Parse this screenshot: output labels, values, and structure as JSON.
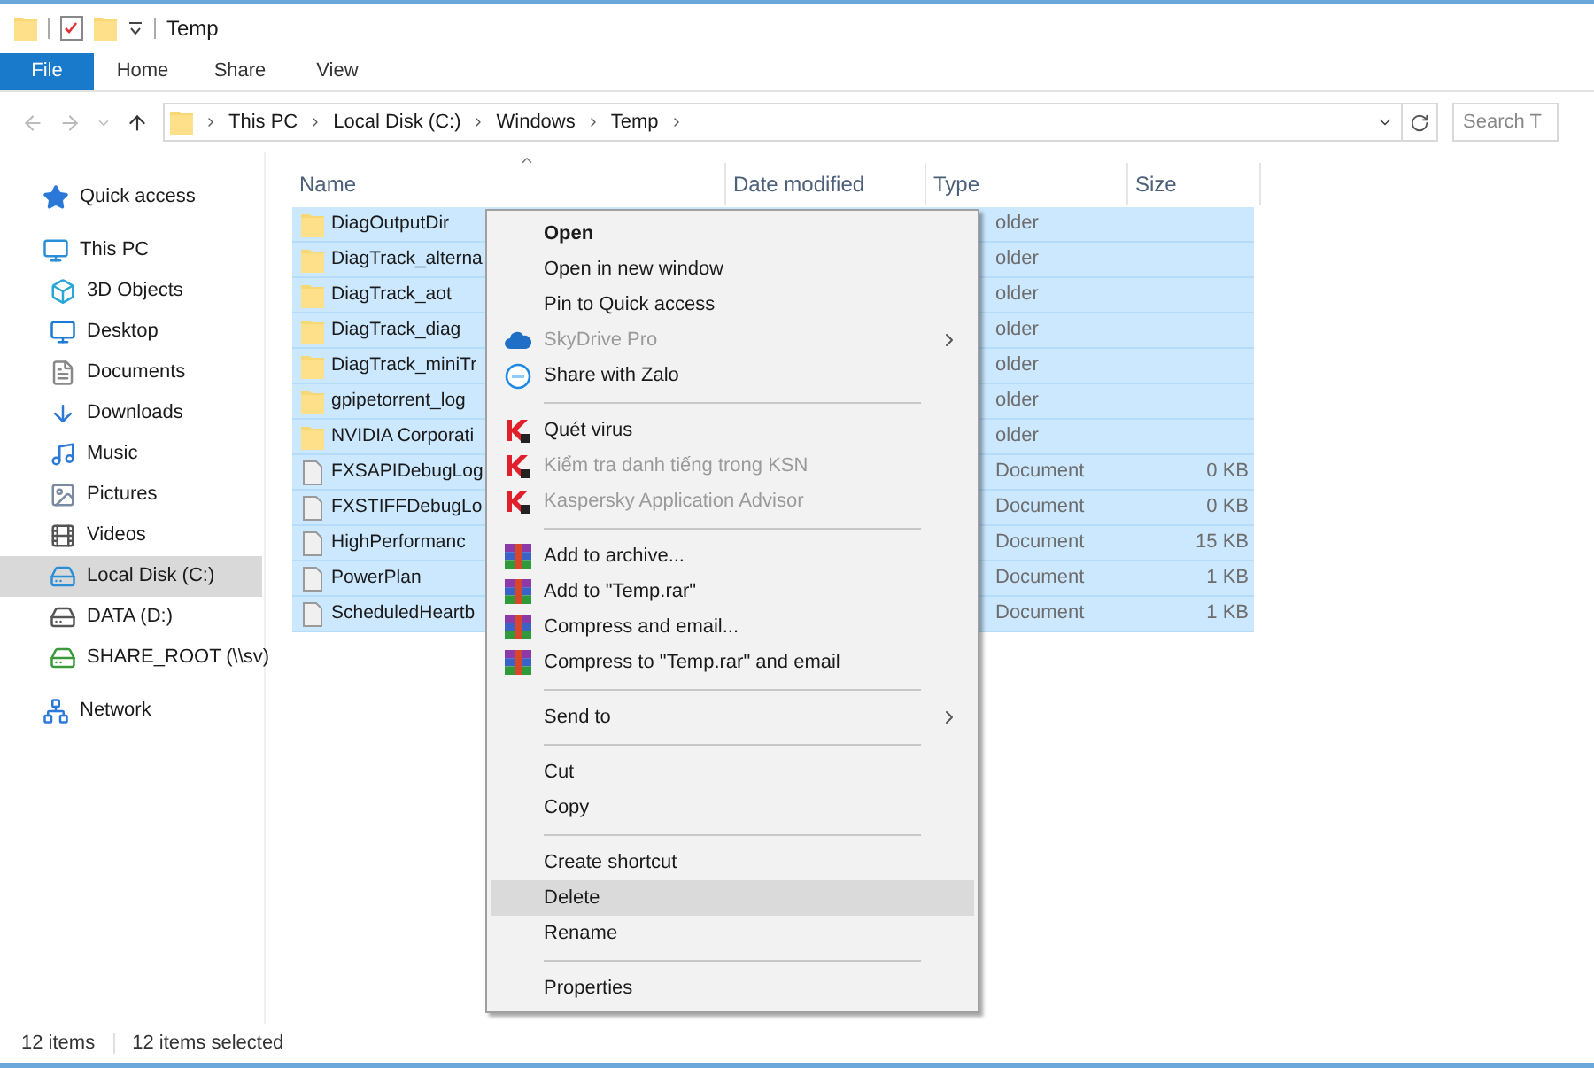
{
  "window": {
    "title": "Temp"
  },
  "ribbon_tabs": [
    {
      "label": "File",
      "selected": true
    },
    {
      "label": "Home",
      "selected": false
    },
    {
      "label": "Share",
      "selected": false
    },
    {
      "label": "View",
      "selected": false
    }
  ],
  "address_bar": {
    "breadcrumbs": [
      "This PC",
      "Local Disk (C:)",
      "Windows",
      "Temp"
    ]
  },
  "search": {
    "placeholder": "Search T"
  },
  "sidebar": {
    "items": [
      {
        "label": "Quick access",
        "kind": "quick",
        "selected": false
      },
      {
        "label": "This PC",
        "kind": "pc",
        "selected": false,
        "children": [
          {
            "label": "3D Objects",
            "kind": "objects",
            "selected": false
          },
          {
            "label": "Desktop",
            "kind": "desktop",
            "selected": false
          },
          {
            "label": "Documents",
            "kind": "documents",
            "selected": false
          },
          {
            "label": "Downloads",
            "kind": "downloads",
            "selected": false
          },
          {
            "label": "Music",
            "kind": "music",
            "selected": false
          },
          {
            "label": "Pictures",
            "kind": "pictures",
            "selected": false
          },
          {
            "label": "Videos",
            "kind": "videos",
            "selected": false
          },
          {
            "label": "Local Disk (C:)",
            "kind": "system_drive",
            "selected": true
          },
          {
            "label": "DATA (D:)",
            "kind": "drive",
            "selected": false
          },
          {
            "label": "SHARE_ROOT (\\\\sv)",
            "kind": "net_drive",
            "selected": false
          }
        ]
      },
      {
        "label": "Network",
        "kind": "network",
        "selected": false
      }
    ]
  },
  "table": {
    "columns": [
      "Name",
      "Date modified",
      "Type",
      "Size"
    ],
    "rows": [
      {
        "name": "DiagOutputDir",
        "kind": "folder",
        "type": "older",
        "selected": true
      },
      {
        "name": "DiagTrack_alterna",
        "kind": "folder",
        "type": "older",
        "selected": true
      },
      {
        "name": "DiagTrack_aot",
        "kind": "folder",
        "type": "older",
        "selected": true
      },
      {
        "name": "DiagTrack_diag",
        "kind": "folder",
        "type": "older",
        "selected": true
      },
      {
        "name": "DiagTrack_miniTr",
        "kind": "folder",
        "type": "older",
        "selected": true
      },
      {
        "name": "gpipetorrent_log",
        "kind": "folder",
        "type": "older",
        "selected": true
      },
      {
        "name": "NVIDIA Corporati",
        "kind": "folder",
        "type": "older",
        "selected": true
      },
      {
        "name": "FXSAPIDebugLog",
        "kind": "file",
        "type": "Document",
        "size": "0 KB",
        "selected": true
      },
      {
        "name": "FXSTIFFDebugLo",
        "kind": "file",
        "type": "Document",
        "size": "0 KB",
        "selected": true
      },
      {
        "name": "HighPerformanc",
        "kind": "file",
        "type": "Document",
        "size": "15 KB",
        "selected": true
      },
      {
        "name": "PowerPlan",
        "kind": "file",
        "type": "Document",
        "size": "1 KB",
        "selected": true
      },
      {
        "name": "ScheduledHeartb",
        "kind": "file",
        "type": "Document",
        "size": "1 KB",
        "selected": true
      }
    ]
  },
  "context_menu": {
    "sections": [
      [
        {
          "label": "Open",
          "kind": "plain",
          "default": true,
          "disabled": false,
          "submenu": false,
          "selected": false
        },
        {
          "label": "Open in new window",
          "kind": "plain",
          "default": false,
          "disabled": false,
          "submenu": false,
          "selected": false
        },
        {
          "label": "Pin to Quick access",
          "kind": "plain",
          "default": false,
          "disabled": false,
          "submenu": false,
          "selected": false
        },
        {
          "label": "SkyDrive Pro",
          "kind": "cloud",
          "default": false,
          "disabled": true,
          "submenu": true,
          "selected": false
        },
        {
          "label": "Share with Zalo",
          "kind": "zalo",
          "default": false,
          "disabled": false,
          "submenu": false,
          "selected": false
        }
      ],
      [
        {
          "label": "Quét virus",
          "kind": "antivirus",
          "default": false,
          "disabled": false,
          "submenu": false,
          "selected": false
        },
        {
          "label": "Kiểm tra danh tiếng trong KSN",
          "kind": "antivirus",
          "default": false,
          "disabled": true,
          "submenu": false,
          "selected": false
        },
        {
          "label": "Kaspersky Application Advisor",
          "kind": "antivirus",
          "default": false,
          "disabled": true,
          "submenu": false,
          "selected": false
        }
      ],
      [
        {
          "label": "Add to archive...",
          "kind": "archive",
          "default": false,
          "disabled": false,
          "submenu": false,
          "selected": false
        },
        {
          "label": "Add to \"Temp.rar\"",
          "kind": "archive",
          "default": false,
          "disabled": false,
          "submenu": false,
          "selected": false
        },
        {
          "label": "Compress and email...",
          "kind": "archive",
          "default": false,
          "disabled": false,
          "submenu": false,
          "selected": false
        },
        {
          "label": "Compress to \"Temp.rar\" and email",
          "kind": "archive",
          "default": false,
          "disabled": false,
          "submenu": false,
          "selected": false
        }
      ],
      [
        {
          "label": "Send to",
          "kind": "plain",
          "default": false,
          "disabled": false,
          "submenu": true,
          "selected": false
        }
      ],
      [
        {
          "label": "Cut",
          "kind": "plain",
          "default": false,
          "disabled": false,
          "submenu": false,
          "selected": false
        },
        {
          "label": "Copy",
          "kind": "plain",
          "default": false,
          "disabled": false,
          "submenu": false,
          "selected": false
        }
      ],
      [
        {
          "label": "Create shortcut",
          "kind": "plain",
          "default": false,
          "disabled": false,
          "submenu": false,
          "selected": false
        },
        {
          "label": "Delete",
          "kind": "plain",
          "default": false,
          "disabled": false,
          "submenu": false,
          "selected": true
        },
        {
          "label": "Rename",
          "kind": "plain",
          "default": false,
          "disabled": false,
          "submenu": false,
          "selected": false
        }
      ],
      [
        {
          "label": "Properties",
          "kind": "plain",
          "default": false,
          "disabled": false,
          "submenu": false,
          "selected": false
        }
      ]
    ]
  },
  "status_bar": {
    "item_count": "12 items",
    "selection": "12 items selected"
  }
}
